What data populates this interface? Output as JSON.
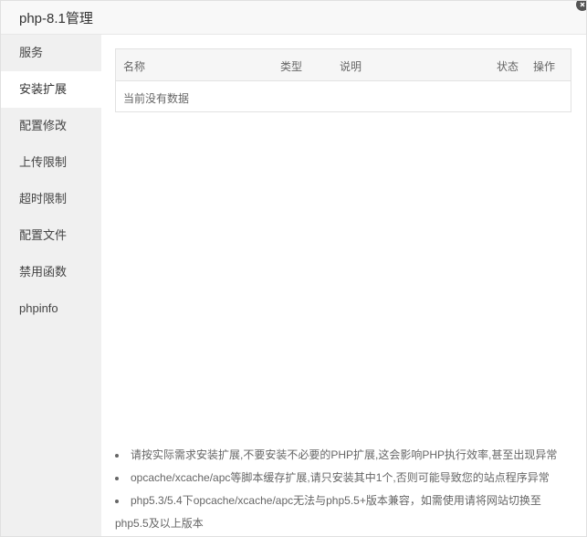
{
  "window": {
    "title": "php-8.1管理"
  },
  "sidebar": {
    "items": [
      {
        "label": "服务"
      },
      {
        "label": "安装扩展",
        "active": true
      },
      {
        "label": "配置修改"
      },
      {
        "label": "上传限制"
      },
      {
        "label": "超时限制"
      },
      {
        "label": "配置文件"
      },
      {
        "label": "禁用函数"
      },
      {
        "label": "phpinfo"
      }
    ]
  },
  "table": {
    "columns": [
      "名称",
      "类型",
      "说明",
      "状态",
      "操作"
    ],
    "empty_text": "当前没有数据"
  },
  "tips": [
    "请按实际需求安装扩展,不要安装不必要的PHP扩展,这会影响PHP执行效率,甚至出现异常",
    "opcache/xcache/apc等脚本缓存扩展,请只安装其中1个,否则可能导致您的站点程序异常",
    "php5.3/5.4下opcache/xcache/apc无法与php5.5+版本兼容，如需使用请将网站切换至php5.5及以上版本"
  ],
  "icons": {
    "close": "close-icon"
  },
  "colors": {
    "sidebar_bg": "#f0f0f0",
    "active_bg": "#ffffff",
    "header_bg": "#f6f6f6"
  }
}
